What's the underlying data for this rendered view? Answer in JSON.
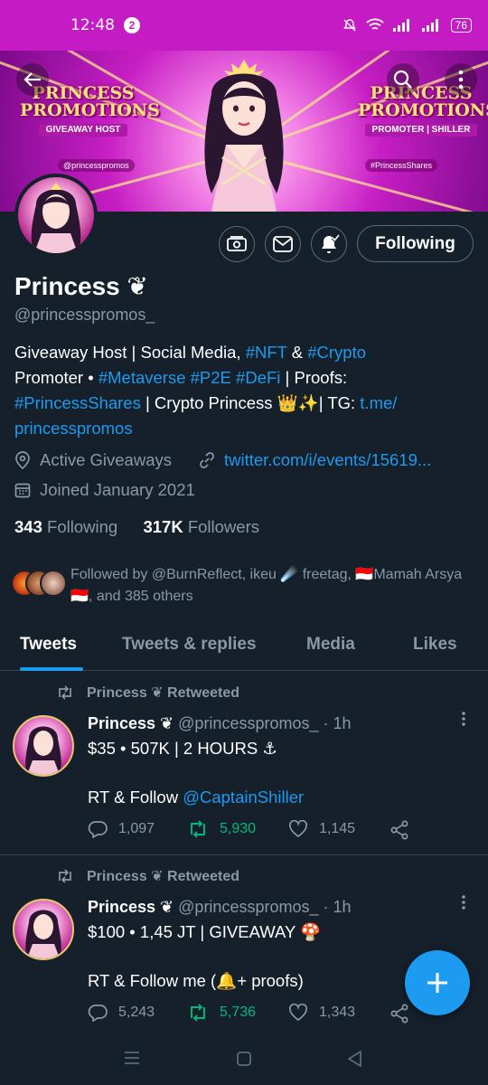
{
  "status_bar": {
    "time": "12:48",
    "notification_count": "2",
    "battery": "76"
  },
  "banner": {
    "left_brand_line1": "PRINCESS",
    "left_brand_line2": "PROMOTIONS",
    "left_subtitle": "GIVEAWAY HOST",
    "left_handle": "@princesspromos",
    "right_brand_line1": "PRINCESS",
    "right_brand_line2": "PROMOTIONS",
    "right_subtitle": "PROMOTER | SHILLER",
    "right_handle": "#PrincessShares"
  },
  "profile": {
    "follow_button_label": "Following",
    "display_name": "Princess",
    "name_badge": "❦",
    "handle": "@princesspromos_",
    "bio": {
      "line1_a": "Giveaway Host | Social Media, ",
      "line1_tag1": "#NFT",
      "line1_b": " & ",
      "line1_tag2": "#Crypto",
      "line2_a": "Promoter • ",
      "line2_tag1": "#Metaverse",
      "line2_tag2": "#P2E",
      "line2_tag3": "#DeFi",
      "line2_b": " | Proofs:",
      "line3_tag": "#PrincessShares",
      "line3_b": " | Crypto Princess 👑✨| TG: ",
      "line3_link": "t.me/",
      "line4_link": "princesspromos"
    },
    "location": "Active Giveaways",
    "website": "twitter.com/i/events/15619...",
    "joined": "Joined January 2021",
    "following_count": "343",
    "following_label": "Following",
    "followers_count": "317K",
    "followers_label": "Followers",
    "followed_by": "Followed by @BurnReflect, ikeu ☄️ freetag, 🇮🇩Mamah Arsya🇮🇩, and 385 others"
  },
  "tabs": [
    {
      "label": "Tweets",
      "active": true
    },
    {
      "label": "Tweets & replies",
      "active": false
    },
    {
      "label": "Media",
      "active": false
    },
    {
      "label": "Likes",
      "active": false
    }
  ],
  "tweets": [
    {
      "retweet_label": "Princess ❦ Retweeted",
      "author": "Princess ❦",
      "handle": "@princesspromos_",
      "time": "· 1h",
      "line1": "$35 • 507K | 2 HOURS ⚓",
      "line2_a": "RT & Follow ",
      "line2_mention": "@CaptainShiller",
      "replies": "1,097",
      "retweets": "5,930",
      "likes": "1,145"
    },
    {
      "retweet_label": "Princess ❦ Retweeted",
      "author": "Princess ❦",
      "handle": "@princesspromos_",
      "time": "· 1h",
      "line1": "$100 • 1,45 JT | GIVEAWAY 🍄",
      "line2_a": "RT & Follow me (🔔+ proofs)",
      "line2_mention": "",
      "replies": "5,243",
      "retweets": "5,736",
      "likes": "1,343"
    }
  ],
  "colors": {
    "accent": "#1d9bf0",
    "retweet_green": "#00ba7c",
    "background": "#15202b",
    "status_bar": "#c51bc5"
  }
}
